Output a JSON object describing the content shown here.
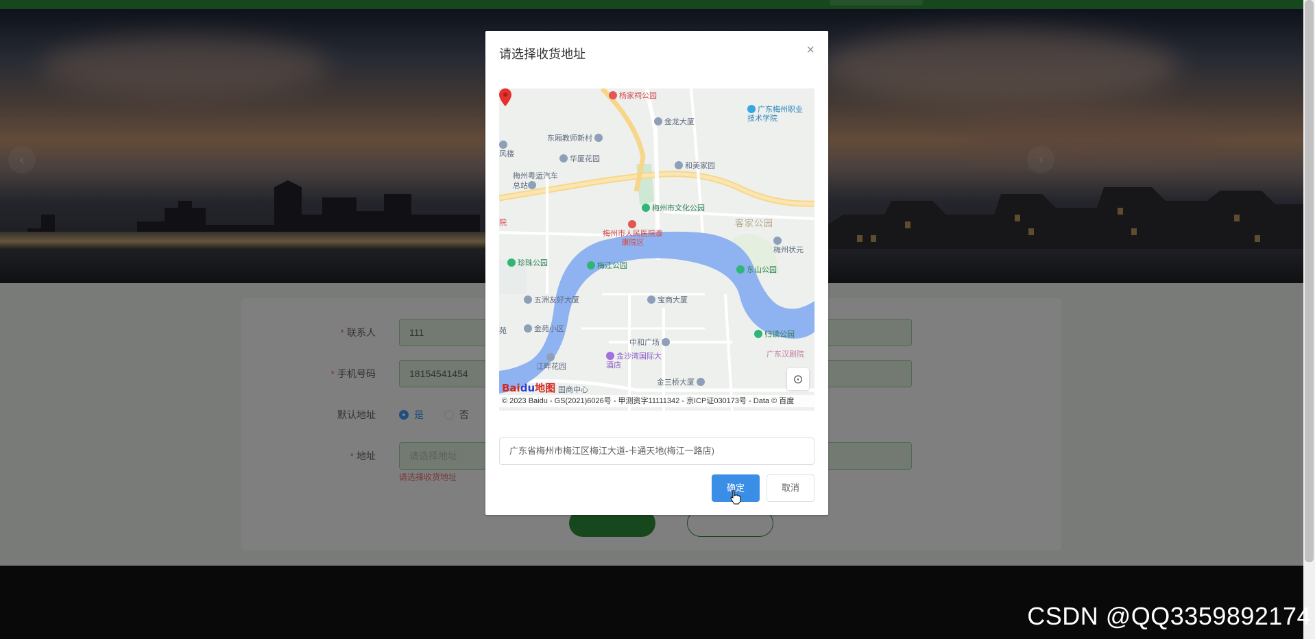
{
  "form": {
    "contact_label": "联系人",
    "contact_value": "111",
    "phone_label": "手机号码",
    "phone_value": "18154541454",
    "default_label": "默认地址",
    "default_yes": "是",
    "default_no": "否",
    "address_label": "地址",
    "address_placeholder": "请选择地址",
    "address_error": "请选择收货地址"
  },
  "dialog": {
    "title": "请选择收货地址",
    "close_symbol": "×",
    "address_value": "广东省梅州市梅江区梅江大道-卡通天地(梅江一路店)",
    "confirm_label": "确定",
    "cancel_label": "取消"
  },
  "map": {
    "pois": {
      "p1": "杨家祠公园",
      "p2": "广东梅州职业技术学院",
      "p3": "金龙大厦",
      "p4": "东厢教师新村",
      "p5": "风楼",
      "p6": "华厦花园",
      "p7": "梅州粤运汽车总站",
      "p8": "和美家园",
      "p9": "梅州市文化公园",
      "p10": "客家公园",
      "p11": "梅州市人民医院泰康院区",
      "p12": "梅州状元",
      "p13": "珍珠公园",
      "p14": "梅江公园",
      "p15": "东山公园",
      "p16": "五洲友好大厦",
      "p17": "宝商大厦",
      "p18": "金苑小区",
      "p19": "苑",
      "p20": "中和广场",
      "p21": "归读公园",
      "p22": "广东汉剧院",
      "p23": "金沙湾国际大酒店",
      "p24": "江畔花园",
      "p25": "金三桥大厦",
      "p26": "国商中心",
      "p27": "院"
    },
    "logo_text": "Bai",
    "logo_paw": "du",
    "logo_suffix": "地图",
    "copyright": "© 2023 Baidu - GS(2021)6026号 - 甲测资字11111342 - 京ICP证030173号 - Data © 百度"
  },
  "banner": {
    "prev_arrow": "‹",
    "next_arrow": "›"
  },
  "watermark": "CSDN @QQ3359892174",
  "icons": {
    "locate": "⊙"
  }
}
